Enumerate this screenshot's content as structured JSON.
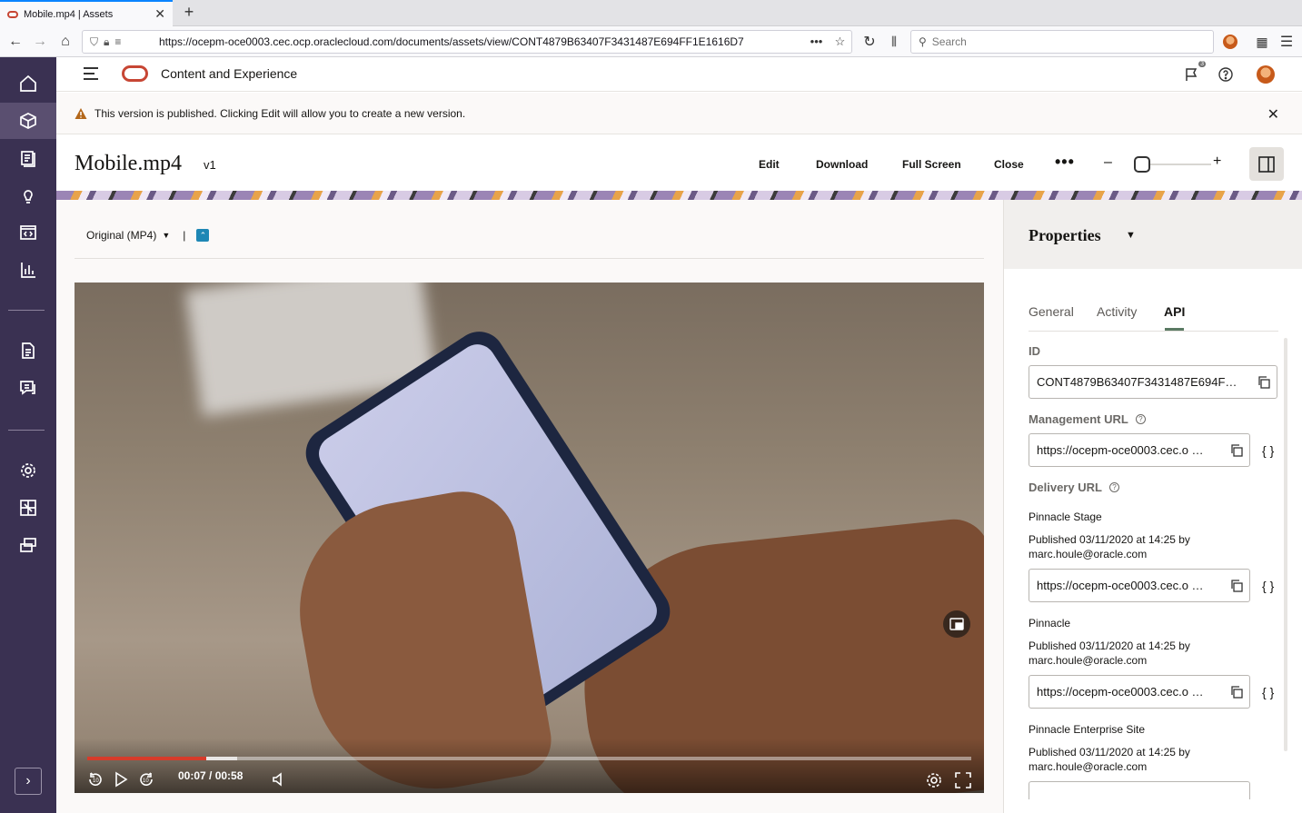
{
  "browser": {
    "tab_title": "Mobile.mp4 | Assets",
    "url": "https://ocepm-oce0003.cec.ocp.oraclecloud.com/documents/assets/view/CONT4879B63407F3431487E694FF1E1616D7",
    "search_placeholder": "Search"
  },
  "app": {
    "title": "Content and Experience",
    "notification_count": "3"
  },
  "banner": {
    "text": "This version is published. Clicking Edit will allow you to create a new version."
  },
  "asset": {
    "name": "Mobile.mp4",
    "version": "v1"
  },
  "toolbar": {
    "edit_label": "Edit",
    "download_label": "Download",
    "fullscreen_label": "Full Screen",
    "close_label": "Close",
    "more_label": "•••"
  },
  "rendition": {
    "selected": "Original (MP4)",
    "separator": "|"
  },
  "video": {
    "timecode": "00:07 / 00:58",
    "played_fraction": 0.135,
    "buffered_fraction": 0.17
  },
  "properties": {
    "title": "Properties",
    "tabs": [
      {
        "label": "General"
      },
      {
        "label": "Activity"
      },
      {
        "label": "API"
      }
    ],
    "id_label": "ID",
    "id_value": "CONT4879B63407F3431487E694F…",
    "management_url_label": "Management URL",
    "management_url_value": "https://ocepm-oce0003.cec.o …",
    "delivery_url_label": "Delivery URL",
    "braces": "{ }",
    "channels": [
      {
        "name": "Pinnacle Stage",
        "published_line": "Published 03/11/2020 at 14:25 by",
        "published_by": "marc.houle@oracle.com",
        "url": "https://ocepm-oce0003.cec.o …"
      },
      {
        "name": "Pinnacle",
        "published_line": "Published 03/11/2020 at 14:25 by",
        "published_by": "marc.houle@oracle.com",
        "url": "https://ocepm-oce0003.cec.o …"
      },
      {
        "name": "Pinnacle Enterprise Site",
        "published_line": "Published 03/11/2020 at 14:25 by",
        "published_by": "marc.houle@oracle.com",
        "url": ""
      }
    ]
  },
  "colors": {
    "rail_bg": "#3a3152",
    "oracle_red": "#c74634",
    "progress_red": "#d63b2a",
    "tab_accent": "#5a7a63"
  }
}
